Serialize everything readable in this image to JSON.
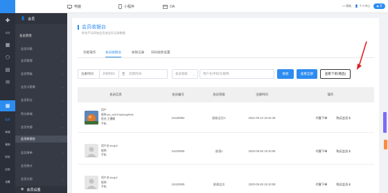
{
  "topbar": {
    "tabs": [
      {
        "label": "电脑",
        "icon": "desktop-icon"
      },
      {
        "label": "小程序",
        "icon": "mobile-icon"
      },
      {
        "label": "OA",
        "icon": "window-icon"
      }
    ],
    "right": {
      "help": "帮助",
      "user": "个人中心",
      "toggle": "开"
    }
  },
  "rail": {
    "items": [
      "会员",
      "商城",
      "营销",
      "财务",
      "应用",
      "设置"
    ]
  },
  "submenu": {
    "header": "会员",
    "group": "会员管理",
    "items": [
      "会员列表",
      "会员管理",
      "会员等级",
      "会员卡套餐",
      "会员积分",
      "积分商城",
      "会员充值",
      "会员收银台",
      "会员清单",
      "会员统计",
      "会员分组"
    ],
    "active_index": 7,
    "footer": "会员设置"
  },
  "page": {
    "title": "会员收银台",
    "subtitle": "前台手动添加会员或会员记录数据",
    "tabs": [
      "功能操作",
      "会员收银台",
      "收银记录",
      "扫码收款设置"
    ],
    "active_tab": 1
  },
  "filters": {
    "time_label": "注册时间：",
    "start_placeholder": "开始时间",
    "range_sep": "至",
    "end_placeholder": "结束时间",
    "level_placeholder": "会员等级",
    "search_placeholder": "用户名/手机号/昵称",
    "search_btn": "搜索",
    "viewall_btn": "查看全部",
    "order_btn": "查看下单(赠品)"
  },
  "table": {
    "headers": [
      "会员信息",
      "会员编号",
      "会员等级",
      "注册时间",
      "操作"
    ],
    "rows": [
      {
        "info": [
          "用户",
          "昵称:ws_dd157ejAevgWWk",
          "姓名:王姗姗",
          "手机:"
        ],
        "number": "24430882",
        "level": "超级会员V",
        "time": "2021-05-13 15:44:48",
        "actions": [
          "代客下单",
          "购买会员卡"
        ]
      },
      {
        "info": [
          "用户名:shuju3",
          "昵称:",
          "手机:"
        ],
        "number": "24420906",
        "level": "普通1",
        "time": "2020-09-28 19:10:08",
        "actions": [
          "代客下单",
          "购买会员卡"
        ]
      },
      {
        "info": [
          "用户名:shuju2",
          "昵称:",
          "手机:"
        ],
        "number": "24420905",
        "level": "普通会员",
        "time": "2020-09-28 19:10:08",
        "actions": [
          "代客下单",
          "购买会员卡"
        ]
      }
    ]
  },
  "colors": {
    "accent": "#2d8cf0",
    "sidebar": "#363a45",
    "rail": "#2b2f3a",
    "annotation": "#e02020"
  }
}
